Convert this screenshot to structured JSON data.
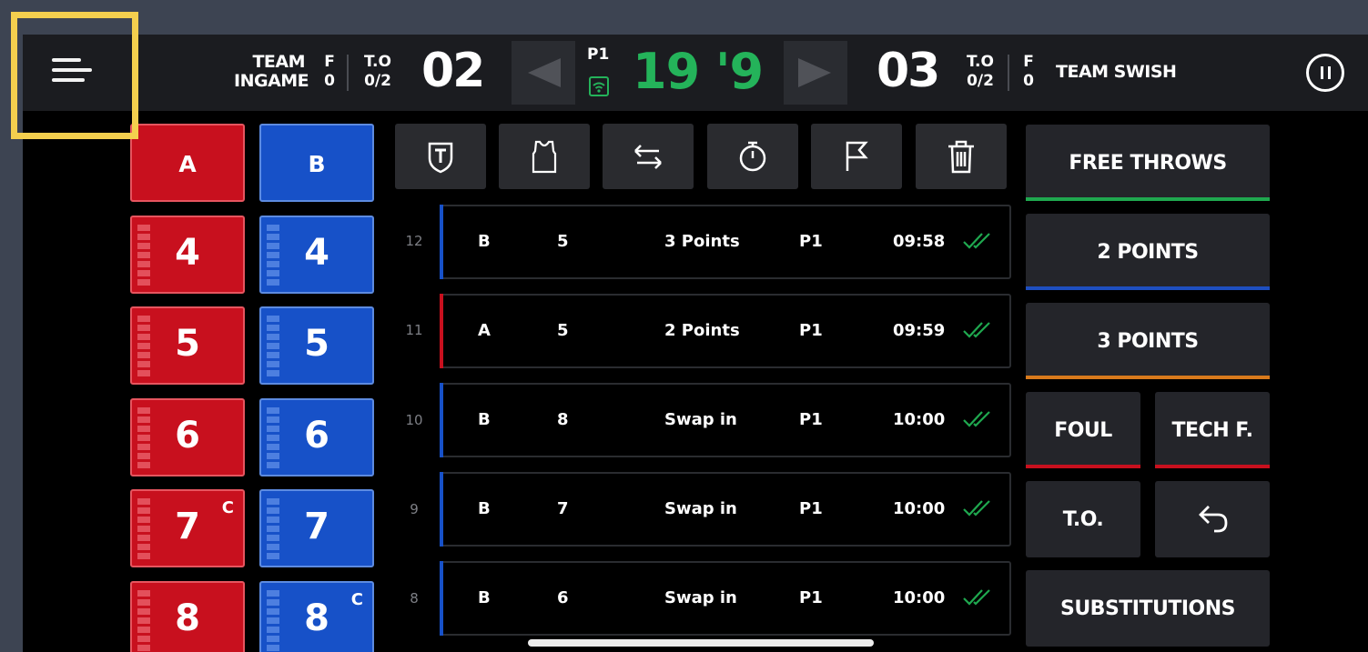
{
  "header": {
    "team_left_line1": "TEAM",
    "team_left_line2": "INGAME",
    "left_fouls_label": "F",
    "left_fouls_value": "0",
    "left_to_label": "T.O",
    "left_to_value": "0/2",
    "score_left": "02",
    "period": "P1",
    "clock": "19 '9",
    "score_right": "03",
    "right_to_label": "T.O",
    "right_to_value": "0/2",
    "right_fouls_label": "F",
    "right_fouls_value": "0",
    "team_right": "TEAM SWISH"
  },
  "players": {
    "team_a": [
      {
        "label": "A"
      },
      {
        "label": "4"
      },
      {
        "label": "5"
      },
      {
        "label": "6"
      },
      {
        "label": "7",
        "captain": "C"
      },
      {
        "label": "8"
      }
    ],
    "team_b": [
      {
        "label": "B"
      },
      {
        "label": "4"
      },
      {
        "label": "5"
      },
      {
        "label": "6"
      },
      {
        "label": "7"
      },
      {
        "label": "8",
        "captain": "C"
      }
    ]
  },
  "toolbar": {
    "icons": [
      "team-badge-icon",
      "jersey-icon",
      "swap-arrows-icon",
      "stopwatch-icon",
      "flag-icon",
      "trash-icon"
    ]
  },
  "events": [
    {
      "index": "12",
      "team": "B",
      "player": "5",
      "action": "3 Points",
      "period": "P1",
      "time": "09:58",
      "accent": "#1751c8"
    },
    {
      "index": "11",
      "team": "A",
      "player": "5",
      "action": "2 Points",
      "period": "P1",
      "time": "09:59",
      "accent": "#c8101e"
    },
    {
      "index": "10",
      "team": "B",
      "player": "8",
      "action": "Swap in",
      "period": "P1",
      "time": "10:00",
      "accent": "#1751c8"
    },
    {
      "index": "9",
      "team": "B",
      "player": "7",
      "action": "Swap in",
      "period": "P1",
      "time": "10:00",
      "accent": "#1751c8"
    },
    {
      "index": "8",
      "team": "B",
      "player": "6",
      "action": "Swap in",
      "period": "P1",
      "time": "10:00",
      "accent": "#1751c8"
    }
  ],
  "actions": {
    "free_throws": "FREE THROWS",
    "two_points": "2 POINTS",
    "three_points": "3 POINTS",
    "foul": "FOUL",
    "tech_foul": "TECH F.",
    "timeout": "T.O.",
    "substitutions": "SUBSTITUTIONS"
  },
  "colors": {
    "team_a": "#c8101e",
    "team_b": "#1751c8",
    "clock_green": "#24b35a",
    "free_throws_line": "#1fa84f",
    "two_points_line": "#1e4fc0",
    "three_points_line": "#d97a1c",
    "foul_line": "#c8101e",
    "highlight": "#f4cf4e"
  }
}
